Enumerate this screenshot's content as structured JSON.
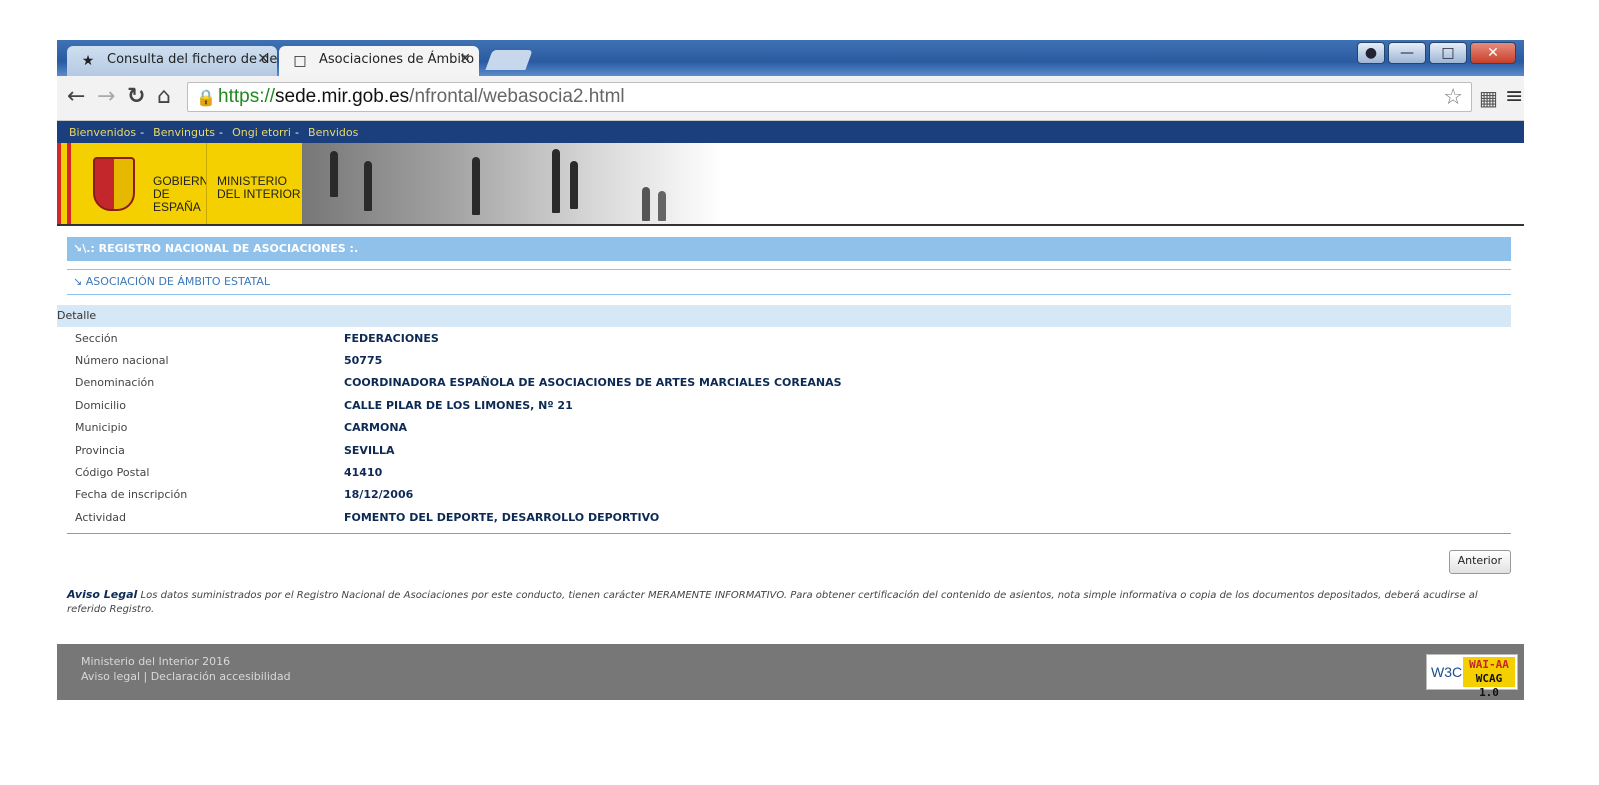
{
  "browser": {
    "tabs": [
      {
        "title": "Consulta del fichero de de",
        "active": false
      },
      {
        "title": "Asociaciones de Ámbito E",
        "active": true
      }
    ],
    "url": {
      "protocol": "https://",
      "host": "sede.mir.gob.es",
      "path": "/nfrontal/webasocia2.html"
    }
  },
  "site": {
    "languages": [
      "Bienvenidos",
      "Benvinguts",
      "Ongi etorri",
      "Benvidos"
    ],
    "gobierno": [
      "GOBIERNO",
      "DE ESPAÑA"
    ],
    "ministerio": [
      "MINISTERIO",
      "DEL INTERIOR"
    ]
  },
  "page": {
    "heading": "\\.: REGISTRO NACIONAL DE ASOCIACIONES :.",
    "subheading": "ASOCIACIÓN DE ÁMBITO ESTATAL",
    "detail_title": "Detalle",
    "rows": [
      {
        "label": "Sección",
        "value": "FEDERACIONES"
      },
      {
        "label": "Número nacional",
        "value": "50775"
      },
      {
        "label": "Denominación",
        "value": "COORDINADORA ESPAÑOLA DE ASOCIACIONES DE ARTES MARCIALES COREANAS"
      },
      {
        "label": "Domicilio",
        "value": "CALLE PILAR DE LOS LIMONES, Nº 21"
      },
      {
        "label": "Municipio",
        "value": "CARMONA"
      },
      {
        "label": "Provincia",
        "value": "SEVILLA"
      },
      {
        "label": "Código Postal",
        "value": "41410"
      },
      {
        "label": "Fecha de inscripción",
        "value": "18/12/2006"
      },
      {
        "label": "Actividad",
        "value": "FOMENTO DEL DEPORTE, DESARROLLO DEPORTIVO"
      }
    ],
    "back_button": "Anterior",
    "aviso_title": "Aviso Legal",
    "aviso_text": "Los datos suministrados por el Registro Nacional de Asociaciones por este conducto, tienen carácter MERAMENTE INFORMATIVO. Para obtener certificación del contenido de asientos, nota simple informativa o copia de los documentos depositados, deberá acudirse al referido Registro."
  },
  "footer": {
    "line1": "Ministerio del Interior 2016",
    "line2": "Aviso legal | Declaración accesibilidad",
    "w3c": "W3C",
    "badge_top": "WAI-AA",
    "badge_bottom": "WCAG 1.0"
  }
}
